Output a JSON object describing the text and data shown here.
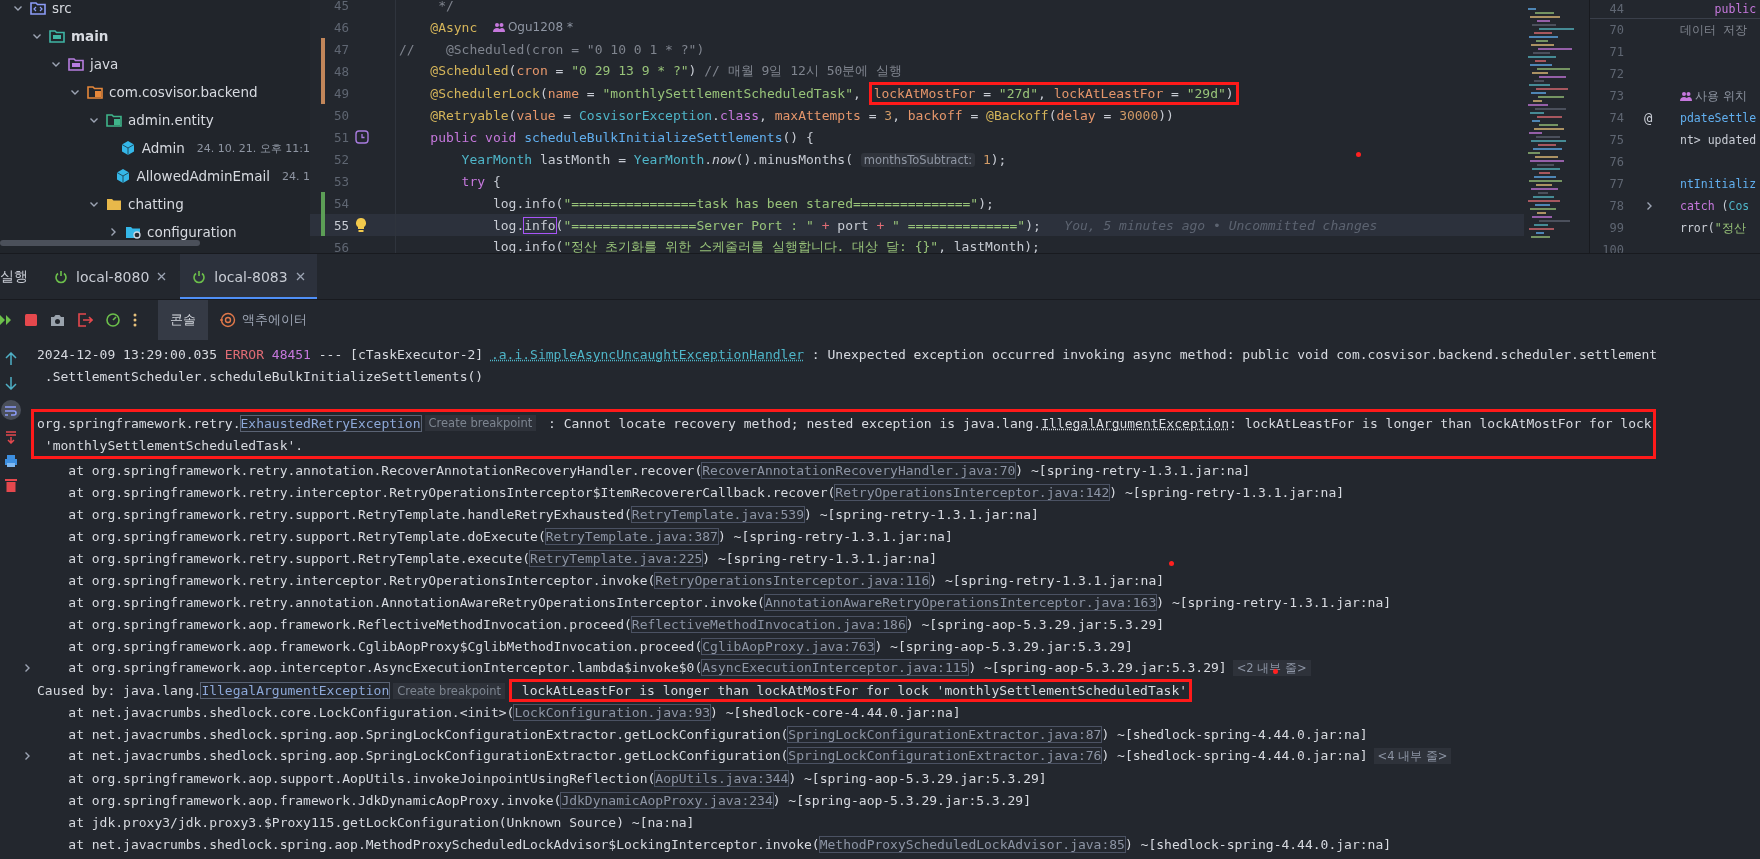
{
  "tree": {
    "items": [
      {
        "label": "src",
        "kind": "source",
        "expanded": true,
        "children": [
          {
            "label": "main",
            "kind": "module",
            "expanded": true,
            "children": [
              {
                "label": "java",
                "kind": "java",
                "expanded": true,
                "children": [
                  {
                    "label": "com.cosvisor.backend",
                    "kind": "package",
                    "expanded": true,
                    "children": [
                      {
                        "label": "admin.entity",
                        "kind": "entity_package",
                        "expanded": true,
                        "children": [
                          {
                            "label": "Admin",
                            "kind": "class",
                            "meta": "24. 10. 21. 오후 11:1"
                          },
                          {
                            "label": "AllowedAdminEmail",
                            "kind": "class",
                            "meta": "24. 1"
                          }
                        ]
                      },
                      {
                        "label": "chatting",
                        "kind": "folder",
                        "expanded": true,
                        "children": [
                          {
                            "label": "configuration",
                            "kind": "config",
                            "expanded": false
                          }
                        ]
                      }
                    ]
                  }
                ]
              }
            ]
          }
        ]
      }
    ]
  },
  "editor": {
    "lines": [
      {
        "number": "45",
        "kind": "code",
        "modified": false,
        "added": false,
        "current": false,
        "tokens": [
          {
            "kind": "comment",
            "text": "     */"
          }
        ]
      },
      {
        "number": "46",
        "kind": "code",
        "modified": false,
        "added": false,
        "current": false,
        "tokens": [
          {
            "kind": "annotation",
            "text": "    @Async  "
          },
          {
            "kind": "author",
            "text": "Ogu1208 *"
          }
        ]
      },
      {
        "number": "47",
        "kind": "code",
        "modified": true,
        "added": false,
        "current": false,
        "tokens": [
          {
            "kind": "comment",
            "text": "//    @Scheduled(cron = \"0 10 0 1 * ?\")"
          }
        ]
      },
      {
        "number": "48",
        "kind": "code",
        "modified": true,
        "added": false,
        "current": false,
        "tokens": [
          {
            "kind": "annotation",
            "text": "    @Scheduled"
          },
          {
            "kind": "plain",
            "text": "("
          },
          {
            "kind": "param",
            "text": "cron"
          },
          {
            "kind": "plain",
            "text": " = "
          },
          {
            "kind": "string",
            "text": "\"0 29 13 9 * ?\""
          },
          {
            "kind": "plain",
            "text": ")"
          },
          {
            "kind": "comment",
            "text": " // 매월 9일 12시 50분에 실행"
          }
        ]
      },
      {
        "number": "49",
        "kind": "code",
        "modified": true,
        "added": false,
        "current": false,
        "tokens": [
          {
            "kind": "annotation",
            "text": "    @SchedulerLock"
          },
          {
            "kind": "plain",
            "text": "("
          },
          {
            "kind": "param",
            "text": "name"
          },
          {
            "kind": "plain",
            "text": " = "
          },
          {
            "kind": "string",
            "text": "\"monthlySettlementScheduledTask\""
          },
          {
            "kind": "plain",
            "text": ", "
          }
        ],
        "boxed": [
          {
            "kind": "param",
            "text": "lockAtMostFor"
          },
          {
            "kind": "plain",
            "text": " = "
          },
          {
            "kind": "string",
            "text": "\"27d\""
          },
          {
            "kind": "plain",
            "text": ", "
          },
          {
            "kind": "param",
            "text": "lockAtLeastFor"
          },
          {
            "kind": "plain",
            "text": " = "
          },
          {
            "kind": "string",
            "text": "\"29d\""
          },
          {
            "kind": "plain",
            "text": ")"
          }
        ]
      },
      {
        "number": "50",
        "kind": "code",
        "modified": false,
        "added": false,
        "current": false,
        "tokens": [
          {
            "kind": "annotation",
            "text": "    @Retryable"
          },
          {
            "kind": "plain",
            "text": "("
          },
          {
            "kind": "param",
            "text": "value"
          },
          {
            "kind": "plain",
            "text": " = "
          },
          {
            "kind": "type",
            "text": "CosvisorException"
          },
          {
            "kind": "plain",
            "text": "."
          },
          {
            "kind": "keyword",
            "text": "class"
          },
          {
            "kind": "plain",
            "text": ", "
          },
          {
            "kind": "param",
            "text": "maxAttempts"
          },
          {
            "kind": "plain",
            "text": " = "
          },
          {
            "kind": "number",
            "text": "3"
          },
          {
            "kind": "plain",
            "text": ", "
          },
          {
            "kind": "param",
            "text": "backoff"
          },
          {
            "kind": "plain",
            "text": " = "
          },
          {
            "kind": "annotation",
            "text": "@Backoff"
          },
          {
            "kind": "plain",
            "text": "("
          },
          {
            "kind": "param",
            "text": "delay"
          },
          {
            "kind": "plain",
            "text": " = "
          },
          {
            "kind": "number",
            "text": "30000"
          },
          {
            "kind": "plain",
            "text": "))"
          }
        ]
      },
      {
        "number": "51",
        "kind": "scheduled",
        "modified": false,
        "added": false,
        "current": false,
        "tokens": [
          {
            "kind": "keyword",
            "text": "    public void "
          },
          {
            "kind": "method",
            "text": "scheduleBulkInitializeSettlements"
          },
          {
            "kind": "plain",
            "text": "() {"
          }
        ]
      },
      {
        "number": "52",
        "kind": "code",
        "modified": false,
        "added": false,
        "current": false,
        "tokens": [
          {
            "kind": "type",
            "text": "        YearMonth"
          },
          {
            "kind": "plain",
            "text": " lastMonth = "
          },
          {
            "kind": "type",
            "text": "YearMonth"
          },
          {
            "kind": "plain",
            "text": "."
          },
          {
            "kind": "static",
            "text": "now"
          },
          {
            "kind": "plain",
            "text": "().minusMonths( "
          },
          {
            "kind": "inlay",
            "text": "monthsToSubtract:"
          },
          {
            "kind": "number",
            "text": " 1"
          },
          {
            "kind": "plain",
            "text": ");"
          }
        ]
      },
      {
        "number": "53",
        "kind": "code",
        "modified": false,
        "added": false,
        "current": false,
        "tokens": [
          {
            "kind": "keyword",
            "text": "        try"
          },
          {
            "kind": "plain",
            "text": " {"
          }
        ]
      },
      {
        "number": "54",
        "kind": "code",
        "modified": false,
        "added": true,
        "current": false,
        "tokens": [
          {
            "kind": "plain",
            "text": "            log.info("
          },
          {
            "kind": "string",
            "text": "\"================task has been stared===============\""
          },
          {
            "kind": "plain",
            "text": ");"
          }
        ]
      },
      {
        "number": "55",
        "kind": "bulb",
        "modified": false,
        "added": true,
        "current": true,
        "tokens": [
          {
            "kind": "plain",
            "text": "            log."
          },
          {
            "kind": "marked",
            "text": "info"
          },
          {
            "kind": "plain",
            "text": "("
          },
          {
            "kind": "string",
            "text": "\"================Server Port : \""
          },
          {
            "kind": "operator",
            "text": " + "
          },
          {
            "kind": "plain",
            "text": "port"
          },
          {
            "kind": "operator",
            "text": " + "
          },
          {
            "kind": "string",
            "text": "\" ==============\""
          },
          {
            "kind": "plain",
            "text": ");   "
          },
          {
            "kind": "blame",
            "text": "You, 5 minutes ago • Uncommitted changes"
          }
        ]
      },
      {
        "number": "56",
        "kind": "code",
        "modified": false,
        "added": false,
        "current": false,
        "tokens": [
          {
            "kind": "plain",
            "text": "            log.info("
          },
          {
            "kind": "string",
            "text": "\"정산 초기화를 위한 스케줄러를 실행합니다. 대상 달: {}\""
          },
          {
            "kind": "plain",
            "text": ", lastMonth);"
          }
        ]
      }
    ]
  },
  "side_editor": {
    "sticky": {
      "number": "44",
      "tokens": [
        {
          "kind": "keyword",
          "text": "     public"
        }
      ]
    },
    "lines": [
      {
        "number": "70",
        "collapsible": false,
        "tokens": [
          {
            "kind": "comment",
            "text": "데이터 저장"
          }
        ]
      },
      {
        "number": "71",
        "collapsible": false
      },
      {
        "number": "72",
        "collapsible": false
      },
      {
        "number": "73",
        "collapsible": false,
        "tokens": [
          {
            "kind": "usages",
            "text": "사용 위치"
          }
        ]
      },
      {
        "number": "74",
        "collapsible": false,
        "gutter": "@",
        "tokens": [
          {
            "kind": "method",
            "text": "pdateSettle"
          }
        ]
      },
      {
        "number": "75",
        "collapsible": false,
        "tokens": [
          {
            "kind": "plain",
            "text": "nt> updated"
          }
        ]
      },
      {
        "number": "76",
        "collapsible": false
      },
      {
        "number": "77",
        "collapsible": false,
        "tokens": [
          {
            "kind": "method",
            "text": "ntInitializ"
          }
        ]
      },
      {
        "number": "78",
        "collapsible": true,
        "tokens": [
          {
            "kind": "keyword",
            "text": "catch"
          },
          {
            "kind": "plain",
            "text": " ("
          },
          {
            "kind": "type",
            "text": "Cos"
          }
        ]
      },
      {
        "number": "99",
        "collapsible": false,
        "tokens": [
          {
            "kind": "plain",
            "text": "rror("
          },
          {
            "kind": "string",
            "text": "\"정산"
          }
        ]
      },
      {
        "number": "100",
        "collapsible": false
      }
    ]
  },
  "run_panel": {
    "title": "실행"
  },
  "run_tabs": [
    {
      "label": "local-8080",
      "selected": false
    },
    {
      "label": "local-8083",
      "selected": true
    }
  ],
  "console_tabs": [
    {
      "label": "콘솔",
      "kind": "console",
      "selected": true
    },
    {
      "label": "액추에이터",
      "kind": "actuator",
      "selected": false
    }
  ],
  "console": {
    "lines": [
      {
        "kind": "line",
        "collapsible": false,
        "tokens": [
          {
            "kind": "text",
            "text": "2024-12-09 13:29:00.035 "
          },
          {
            "kind": "error",
            "text": "ERROR"
          },
          {
            "kind": "pid",
            "text": " 48451"
          },
          {
            "kind": "text",
            "text": " --- [cTaskExecutor-2] "
          },
          {
            "kind": "logger",
            "text": ".a.i.SimpleAsyncUncaughtExceptionHandler"
          },
          {
            "kind": "text",
            "text": " : Unexpected exception occurred invoking async method: public void com.cosvisor.backend.scheduler.settlement"
          }
        ]
      },
      {
        "kind": "line",
        "collapsible": false,
        "tokens": [
          {
            "kind": "text",
            "text": " .SettlementScheduler.scheduleBulkInitializeSettlements()"
          }
        ]
      },
      {
        "kind": "boxed_block",
        "lines": [
          {
            "tokens": [
              {
                "kind": "text",
                "text": "org.springframework.retry."
              },
              {
                "kind": "exception",
                "text": "ExhaustedRetryException"
              },
              {
                "kind": "hint",
                "text": "Create breakpoint"
              },
              {
                "kind": "text",
                "text": " : Cannot locate recovery method; nested exception is java.lang."
              },
              {
                "kind": "underlined",
                "text": "IllegalArgumentException"
              },
              {
                "kind": "text",
                "text": ": lockAtLeastFor is longer than lockAtMostFor for lock"
              }
            ]
          },
          {
            "tokens": [
              {
                "kind": "text",
                "text": " 'monthlySettlementScheduledTask'."
              }
            ]
          }
        ]
      },
      {
        "kind": "line",
        "collapsible": false,
        "tokens": [
          {
            "kind": "text",
            "text": "    at org.springframework.retry.annotation.RecoverAnnotationRecoveryHandler.recover("
          },
          {
            "kind": "link",
            "text": "RecoverAnnotationRecoveryHandler.java:70"
          },
          {
            "kind": "text",
            "text": ") ~[spring-retry-1.3.1.jar:na]"
          }
        ]
      },
      {
        "kind": "line",
        "collapsible": false,
        "tokens": [
          {
            "kind": "text",
            "text": "    at org.springframework.retry.interceptor.RetryOperationsInterceptor$ItemRecovererCallback.recover("
          },
          {
            "kind": "link",
            "text": "RetryOperationsInterceptor.java:142"
          },
          {
            "kind": "text",
            "text": ") ~[spring-retry-1.3.1.jar:na]"
          }
        ]
      },
      {
        "kind": "line",
        "collapsible": false,
        "tokens": [
          {
            "kind": "text",
            "text": "    at org.springframework.retry.support.RetryTemplate.handleRetryExhausted("
          },
          {
            "kind": "link",
            "text": "RetryTemplate.java:539"
          },
          {
            "kind": "text",
            "text": ") ~[spring-retry-1.3.1.jar:na]"
          }
        ]
      },
      {
        "kind": "line",
        "collapsible": false,
        "tokens": [
          {
            "kind": "text",
            "text": "    at org.springframework.retry.support.RetryTemplate.doExecute("
          },
          {
            "kind": "link",
            "text": "RetryTemplate.java:387"
          },
          {
            "kind": "text",
            "text": ") ~[spring-retry-1.3.1.jar:na]"
          }
        ]
      },
      {
        "kind": "line",
        "collapsible": false,
        "tokens": [
          {
            "kind": "text",
            "text": "    at org.springframework.retry.support.RetryTemplate.execute("
          },
          {
            "kind": "link",
            "text": "RetryTemplate.java:225"
          },
          {
            "kind": "text",
            "text": ") ~[spring-retry-1.3.1.jar:na]"
          }
        ]
      },
      {
        "kind": "line",
        "collapsible": false,
        "tokens": [
          {
            "kind": "text",
            "text": "    at org.springframework.retry.interceptor.RetryOperationsInterceptor.invoke("
          },
          {
            "kind": "link",
            "text": "RetryOperationsInterceptor.java:116"
          },
          {
            "kind": "text",
            "text": ") ~[spring-retry-1.3.1.jar:na]"
          }
        ]
      },
      {
        "kind": "line",
        "collapsible": false,
        "tokens": [
          {
            "kind": "text",
            "text": "    at org.springframework.retry.annotation.AnnotationAwareRetryOperationsInterceptor.invoke("
          },
          {
            "kind": "link",
            "text": "AnnotationAwareRetryOperationsInterceptor.java:163"
          },
          {
            "kind": "text",
            "text": ") ~[spring-retry-1.3.1.jar:na]"
          }
        ]
      },
      {
        "kind": "line",
        "collapsible": false,
        "tokens": [
          {
            "kind": "text",
            "text": "    at org.springframework.aop.framework.ReflectiveMethodInvocation.proceed("
          },
          {
            "kind": "link",
            "text": "ReflectiveMethodInvocation.java:186"
          },
          {
            "kind": "text",
            "text": ") ~[spring-aop-5.3.29.jar:5.3.29]"
          }
        ]
      },
      {
        "kind": "line",
        "collapsible": false,
        "tokens": [
          {
            "kind": "text",
            "text": "    at org.springframework.aop.framework.CglibAopProxy$CglibMethodInvocation.proceed("
          },
          {
            "kind": "link",
            "text": "CglibAopProxy.java:763"
          },
          {
            "kind": "text",
            "text": ") ~[spring-aop-5.3.29.jar:5.3.29]"
          }
        ]
      },
      {
        "kind": "line",
        "collapsible": true,
        "tokens": [
          {
            "kind": "text",
            "text": "    at org.springframework.aop.interceptor.AsyncExecutionInterceptor.lambda$invoke$0("
          },
          {
            "kind": "link",
            "text": "AsyncExecutionInterceptor.java:115"
          },
          {
            "kind": "text",
            "text": ") ~[spring-aop-5.3.29.jar:5.3.29]"
          },
          {
            "kind": "badge",
            "text": "<2 내부 줄>"
          }
        ]
      },
      {
        "kind": "line",
        "collapsible": false,
        "tokens": [
          {
            "kind": "text",
            "text": "Caused by: java.lang."
          },
          {
            "kind": "exception",
            "text": "IllegalArgumentException"
          },
          {
            "kind": "hint",
            "text": "Create breakpoint"
          }
        ],
        "boxed": [
          {
            "kind": "text",
            "text": " lockAtLeastFor is longer than lockAtMostFor for lock 'monthlySettlementScheduledTask'"
          }
        ]
      },
      {
        "kind": "line",
        "collapsible": false,
        "tokens": [
          {
            "kind": "text",
            "text": "    at net.javacrumbs.shedlock.core.LockConfiguration.<init>("
          },
          {
            "kind": "link",
            "text": "LockConfiguration.java:93"
          },
          {
            "kind": "text",
            "text": ") ~[shedlock-core-4.44.0.jar:na]"
          }
        ]
      },
      {
        "kind": "line",
        "collapsible": false,
        "tokens": [
          {
            "kind": "text",
            "text": "    at net.javacrumbs.shedlock.spring.aop.SpringLockConfigurationExtractor.getLockConfiguration("
          },
          {
            "kind": "link",
            "text": "SpringLockConfigurationExtractor.java:87"
          },
          {
            "kind": "text",
            "text": ") ~[shedlock-spring-4.44.0.jar:na]"
          }
        ]
      },
      {
        "kind": "line",
        "collapsible": true,
        "tokens": [
          {
            "kind": "text",
            "text": "    at net.javacrumbs.shedlock.spring.aop.SpringLockConfigurationExtractor.getLockConfiguration("
          },
          {
            "kind": "link",
            "text": "SpringLockConfigurationExtractor.java:76"
          },
          {
            "kind": "text",
            "text": ") ~[shedlock-spring-4.44.0.jar:na]"
          },
          {
            "kind": "badge",
            "text": "<4 내부 줄>"
          }
        ]
      },
      {
        "kind": "line",
        "collapsible": false,
        "tokens": [
          {
            "kind": "text",
            "text": "    at org.springframework.aop.support.AopUtils.invokeJoinpointUsingReflection("
          },
          {
            "kind": "link",
            "text": "AopUtils.java:344"
          },
          {
            "kind": "text",
            "text": ") ~[spring-aop-5.3.29.jar:5.3.29]"
          }
        ]
      },
      {
        "kind": "line",
        "collapsible": false,
        "tokens": [
          {
            "kind": "text",
            "text": "    at org.springframework.aop.framework.JdkDynamicAopProxy.invoke("
          },
          {
            "kind": "link",
            "text": "JdkDynamicAopProxy.java:234"
          },
          {
            "kind": "text",
            "text": ") ~[spring-aop-5.3.29.jar:5.3.29]"
          }
        ]
      },
      {
        "kind": "line",
        "collapsible": false,
        "tokens": [
          {
            "kind": "text",
            "text": "    at jdk.proxy3/jdk.proxy3.$Proxy115.getLockConfiguration(Unknown Source) ~[na:na]"
          }
        ]
      },
      {
        "kind": "line",
        "collapsible": false,
        "tokens": [
          {
            "kind": "text",
            "text": "    at net.javacrumbs.shedlock.spring.aop.MethodProxyScheduledLockAdvisor$LockingInterceptor.invoke("
          },
          {
            "kind": "link",
            "text": "MethodProxyScheduledLockAdvisor.java:85"
          },
          {
            "kind": "text",
            "text": ") ~[shedlock-spring-4.44.0.jar:na]"
          }
        ]
      }
    ]
  }
}
